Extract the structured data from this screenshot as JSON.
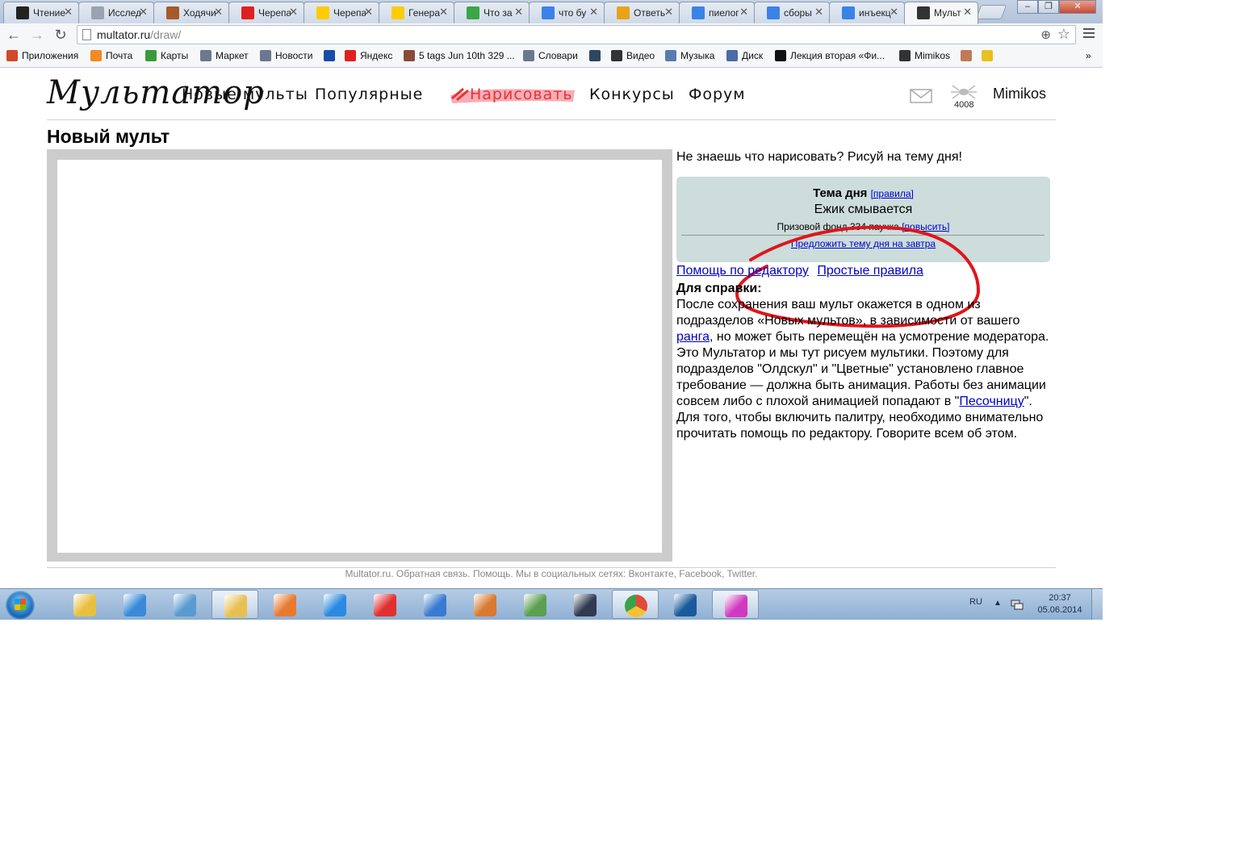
{
  "browser": {
    "tabs": [
      {
        "title": "Чтение",
        "icon": "multator-icon",
        "color": "#222222"
      },
      {
        "title": "Исслед",
        "icon": "page-icon",
        "color": "#9aa4b0"
      },
      {
        "title": "Ходячи",
        "icon": "face-icon",
        "color": "#a55a2a"
      },
      {
        "title": "Черепа",
        "icon": "yandex-icon",
        "color": "#e02020"
      },
      {
        "title": "Черепа",
        "icon": "yandex-play-icon",
        "color": "#ffcc00"
      },
      {
        "title": "Генера",
        "icon": "yandex-play-icon",
        "color": "#ffcc00"
      },
      {
        "title": "Что за",
        "icon": "leaf-icon",
        "color": "#3aa64a"
      },
      {
        "title": "что бу",
        "icon": "google-icon",
        "color": "#3b82e6"
      },
      {
        "title": "Ответь",
        "icon": "question-icon",
        "color": "#e9a21a"
      },
      {
        "title": "пиелог",
        "icon": "google-icon",
        "color": "#3b82e6"
      },
      {
        "title": "сборы",
        "icon": "google-icon",
        "color": "#3b82e6"
      },
      {
        "title": "инъекц",
        "icon": "google-icon",
        "color": "#3b82e6"
      },
      {
        "title": "Мульт",
        "icon": "multator-m-icon",
        "color": "#333333"
      }
    ],
    "url_host": "multator.ru",
    "url_path": "/draw/"
  },
  "bookmarks": [
    {
      "label": "Приложения",
      "icon": "apps-grid-icon",
      "color": "#d04a2a"
    },
    {
      "label": "Почта",
      "icon": "mail-icon",
      "color": "#f08a24"
    },
    {
      "label": "Карты",
      "icon": "maps-icon",
      "color": "#3a9a3a"
    },
    {
      "label": "Маркет",
      "icon": "market-icon",
      "color": "#6b7890"
    },
    {
      "label": "Новости",
      "icon": "news-icon",
      "color": "#6b7890"
    },
    {
      "label": "",
      "icon": "a-icon",
      "color": "#1a4aa8"
    },
    {
      "label": "Яндекс",
      "icon": "yandex-icon",
      "color": "#e02020"
    },
    {
      "label": "5 tags Jun 10th 329 ...",
      "icon": "avatar-icon",
      "color": "#8a4a3a"
    },
    {
      "label": "Словари",
      "icon": "dictionary-icon",
      "color": "#6b7890"
    },
    {
      "label": "",
      "icon": "tumblr-icon",
      "color": "#2c4762"
    },
    {
      "label": "Видео",
      "icon": "video-icon",
      "color": "#333333"
    },
    {
      "label": "Музыка",
      "icon": "music-icon",
      "color": "#5a7ab0"
    },
    {
      "label": "Диск",
      "icon": "disk-icon",
      "color": "#4a6aa8"
    },
    {
      "label": "Лекция вторая «Фи...",
      "icon": "phi-icon",
      "color": "#111111"
    },
    {
      "label": "Mimikos",
      "icon": "multator-m-icon",
      "color": "#333333"
    },
    {
      "label": "",
      "icon": "cake-icon",
      "color": "#c07a5a"
    },
    {
      "label": "",
      "icon": "note-icon",
      "color": "#e8c020"
    }
  ],
  "bookmarks_overflow": "»",
  "site": {
    "logo": "Мультатор",
    "nav": [
      "Новые мульты",
      "Популярные",
      "Нарисовать",
      "Конкурсы",
      "Форум"
    ],
    "spider_count": "4008",
    "username": "Mimikos"
  },
  "main": {
    "title": "Новый мульт",
    "hint": "Не знаешь что нарисовать? Рисуй на тему дня!",
    "theme": {
      "heading": "Тема дня",
      "rules_link": "[правила]",
      "name": "Ежик смывается",
      "prize_text": "Призовой фонд 334 паучка",
      "raise_link": "[повысить]",
      "suggest_link": "Предложить тему дня на завтра"
    },
    "help_link": "Помощь по редактору",
    "rules_link": "Простые правила",
    "info_heading": "Для справки:",
    "info_p1_before": "После сохранения ваш мульт окажется в одном из подразделов «Новых мультов», в зависимости от вашего ",
    "info_p1_link": "ранга",
    "info_p1_after": ", но может быть перемещён на усмотрение модератора.",
    "info_p2_before": "Это Мультатор и мы тут рисуем мультики. Поэтому для подразделов \"Олдскул\" и \"Цветные\" установлено главное требование — должна быть анимация. Работы без анимации совсем либо с плохой анимацией попадают в \"",
    "info_p2_link": "Песочницу",
    "info_p2_after": "\".",
    "info_p3": "Для того, чтобы включить палитру, необходимо внимательно прочитать помощь по редактору. Говорите всем об этом."
  },
  "footer": "Multator.ru. Обратная связь. Помощь. Мы в социальных сетях: Вконтакте, Facebook, Twitter.",
  "taskbar": {
    "apps": [
      {
        "name": "color-picker-icon",
        "color": "#e8c040"
      },
      {
        "name": "mail-icon",
        "color": "#3a8ad8"
      },
      {
        "name": "photo-viewer-icon",
        "color": "#5a9ad0"
      },
      {
        "name": "explorer-folder-icon",
        "color": "#e8c050"
      },
      {
        "name": "media-player-icon",
        "color": "#e87a30"
      },
      {
        "name": "internet-explorer-icon",
        "color": "#2a8ae0"
      },
      {
        "name": "yandex-browser-icon",
        "color": "#e03030"
      },
      {
        "name": "volume-mixer-icon",
        "color": "#3a7ad0"
      },
      {
        "name": "folder-app-icon",
        "color": "#d87a30"
      },
      {
        "name": "game-icon",
        "color": "#5aa050"
      },
      {
        "name": "kmplayer-icon",
        "color": "#303a50"
      },
      {
        "name": "chrome-icon",
        "color": "#e04a3a"
      },
      {
        "name": "photoshop-icon",
        "color": "#1a5a9a"
      },
      {
        "name": "paint-palette-icon",
        "color": "#d03ac0"
      }
    ],
    "lang": "RU",
    "time": "20:37",
    "date": "05.06.2014"
  }
}
